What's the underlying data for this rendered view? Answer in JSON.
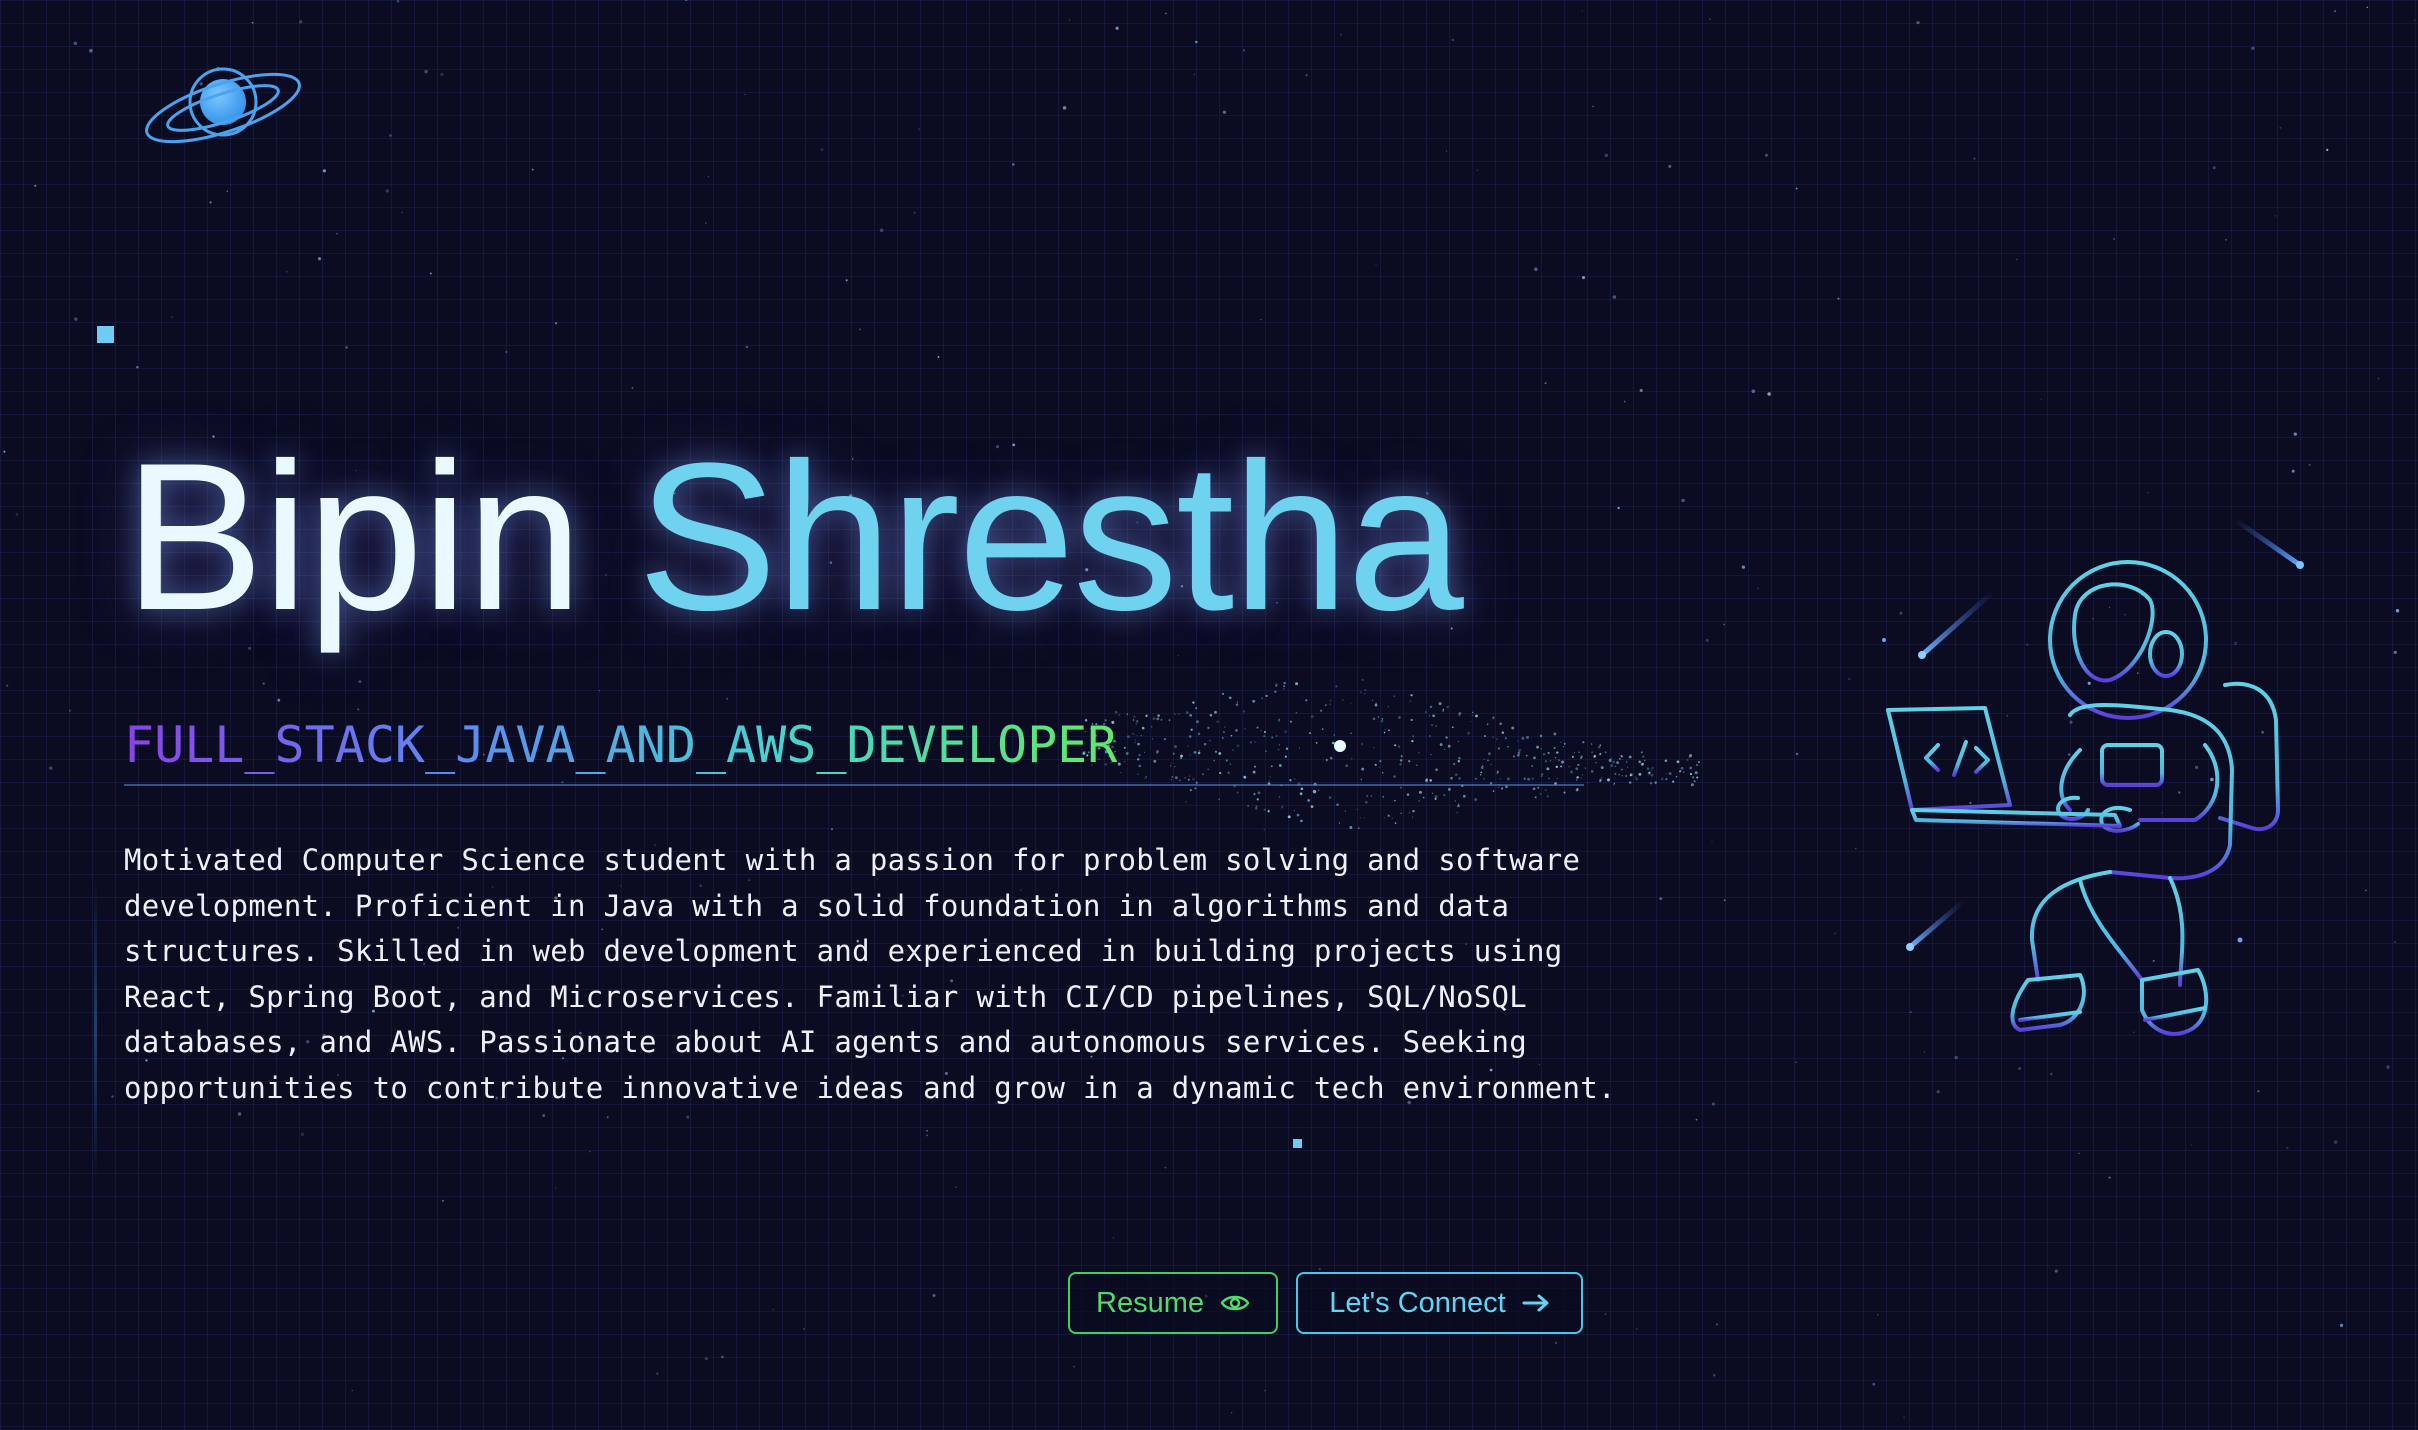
{
  "hero": {
    "first_name": "Bipin",
    "last_name": "Shrestha",
    "role": "FULL_STACK_JAVA_AND_AWS_DEVELOPER",
    "bio": "Motivated Computer Science student with a passion for problem solving and software development. Proficient in Java with a solid foundation in algorithms and data structures. Skilled in web development and experienced in building projects using React, Spring Boot, and Microservices. Familiar with CI/CD pipelines, SQL/NoSQL databases, and AWS. Passionate about AI agents and autonomous services. Seeking opportunities to contribute innovative ideas and grow in a dynamic tech environment."
  },
  "buttons": {
    "resume_label": "Resume",
    "resume_icon": "eye-icon",
    "connect_label": "Let's Connect",
    "connect_icon": "arrow-right-icon"
  },
  "logo": {
    "icon": "planet-icon"
  },
  "illustration": {
    "icon": "astronaut-laptop-icon",
    "code_symbol": "</>"
  },
  "colors": {
    "background": "#0b0c22",
    "name_accent": "#6fd2ef",
    "resume_green": "#4fdc6c",
    "connect_cyan": "#5fd6f4",
    "astronaut_stroke": "#5fd2e6"
  }
}
